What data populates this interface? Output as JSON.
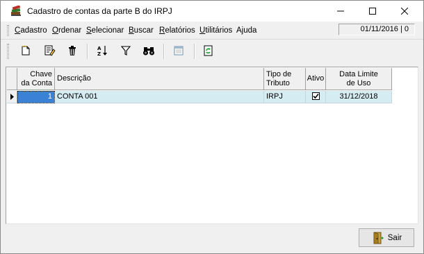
{
  "window": {
    "title": "Cadastro de contas da parte B do IRPJ",
    "app_icon": "books-icon",
    "controls": {
      "minimize": "minimize-icon",
      "maximize": "maximize-icon",
      "close": "close-icon"
    }
  },
  "menu": {
    "items": [
      {
        "label": "Cadastro",
        "underline": "C",
        "rest": "adastro"
      },
      {
        "label": "Ordenar",
        "underline": "O",
        "rest": "rdenar"
      },
      {
        "label": "Selecionar",
        "underline": "S",
        "rest": "elecionar"
      },
      {
        "label": "Buscar",
        "underline": "B",
        "rest": "uscar"
      },
      {
        "label": "Relatórios",
        "underline": "R",
        "rest": "elatórios"
      },
      {
        "label": "Utilitários",
        "underline": "U",
        "rest": "tilitários"
      },
      {
        "label": "Ajuda",
        "underline": "",
        "rest": "Ajuda"
      }
    ],
    "date_status": "01/11/2016 | 0"
  },
  "toolbar": {
    "buttons": [
      {
        "icon": "new-document-icon"
      },
      {
        "icon": "edit-document-icon"
      },
      {
        "icon": "trash-icon"
      },
      {
        "icon": "sort-az-icon"
      },
      {
        "icon": "filter-icon"
      },
      {
        "icon": "binoculars-icon"
      },
      {
        "icon": "report-icon"
      },
      {
        "icon": "refresh-icon"
      }
    ]
  },
  "grid": {
    "columns": [
      {
        "label": "Chave\nda Conta",
        "line1": "Chave",
        "line2": "da Conta"
      },
      {
        "label": "Descrição",
        "line1": "Descrição",
        "line2": ""
      },
      {
        "label": "Tipo de\nTributo",
        "line1": "Tipo de",
        "line2": "Tributo"
      },
      {
        "label": "Ativo",
        "line1": "Ativo",
        "line2": ""
      },
      {
        "label": "Data Limite\nde Uso",
        "line1": "Data Limite",
        "line2": "de Uso"
      }
    ],
    "rows": [
      {
        "chave": "1",
        "descricao": "CONTA 001",
        "tipo": "IRPJ",
        "ativo": true,
        "ativo_mark": "✓",
        "data_limite": "31/12/2018"
      }
    ]
  },
  "footer": {
    "sair_label": "Sair",
    "sair_icon": "exit-door-icon"
  }
}
